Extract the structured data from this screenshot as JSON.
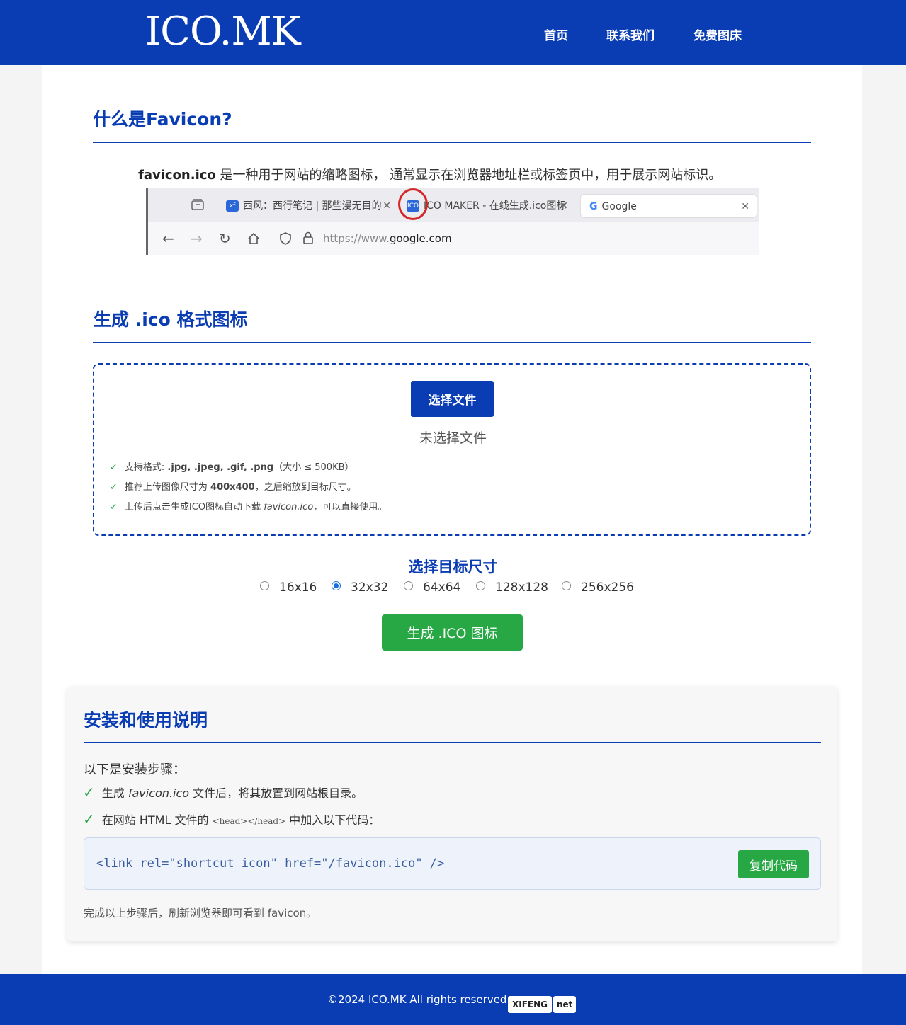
{
  "header": {
    "logo": "ICO.MK",
    "nav": [
      "首页",
      "联系我们",
      "免费图床"
    ]
  },
  "sections": {
    "favicon_title": "什么是Favicon?",
    "generate_title": "生成 .ico 格式图标",
    "install_title": "安装和使用说明"
  },
  "intro": {
    "term": "favicon.ico",
    "text": " 是一种用于网站的缩略图标， 通常显示在浏览器地址栏或标签页中，用于展示网站标识。"
  },
  "browser_example": {
    "tab1_icon": "xf",
    "tab1": "西风：西行笔记 | 那些漫无目的",
    "tab2_icon": "ICO",
    "tab2": "ICO MAKER - 在线生成.ico图标",
    "tab3": "Google",
    "url_prefix": "https://www.",
    "url_domain": "google.com"
  },
  "upload": {
    "choose_button": "选择文件",
    "no_file": "未选择文件",
    "tips": [
      {
        "pre": "支持格式: ",
        "bold": ".jpg, .jpeg, .gif, .png",
        "post": "（大小 ≤ 500KB）"
      },
      {
        "pre": "推荐上传图像尺寸为 ",
        "bold": "400x400",
        "post": "，之后缩放到目标尺寸。"
      },
      {
        "pre": "上传后点击生成ICO图标自动下载 ",
        "italic": "favicon.ico",
        "post": "，可以直接使用。"
      }
    ]
  },
  "sizes": {
    "title": "选择目标尺寸",
    "options": [
      "16x16",
      "32x32",
      "64x64",
      "128x128",
      "256x256"
    ],
    "selected": "32x32"
  },
  "generate_button": "生成 .ICO 图标",
  "install": {
    "intro": "以下是安装步骤：",
    "step1_pre": "生成 ",
    "step1_file": "favicon.ico",
    "step1_post": " 文件后，将其放置到网站根目录。",
    "step2_pre": "在网站 HTML 文件的 ",
    "step2_code": "<head></head>",
    "step2_post": " 中加入以下代码：",
    "code": "<link rel=\"shortcut icon\" href=\"/favicon.ico\" />",
    "copy_button": "复制代码",
    "done": "完成以上步骤后，刷新浏览器即可看到 favicon。"
  },
  "footer": {
    "copyright": "©2024 ICO.MK All rights reserved.",
    "badge1": "XIFENG",
    "badge2": "net"
  },
  "colors": {
    "brand": "#0a3db4",
    "success": "#28a745"
  }
}
